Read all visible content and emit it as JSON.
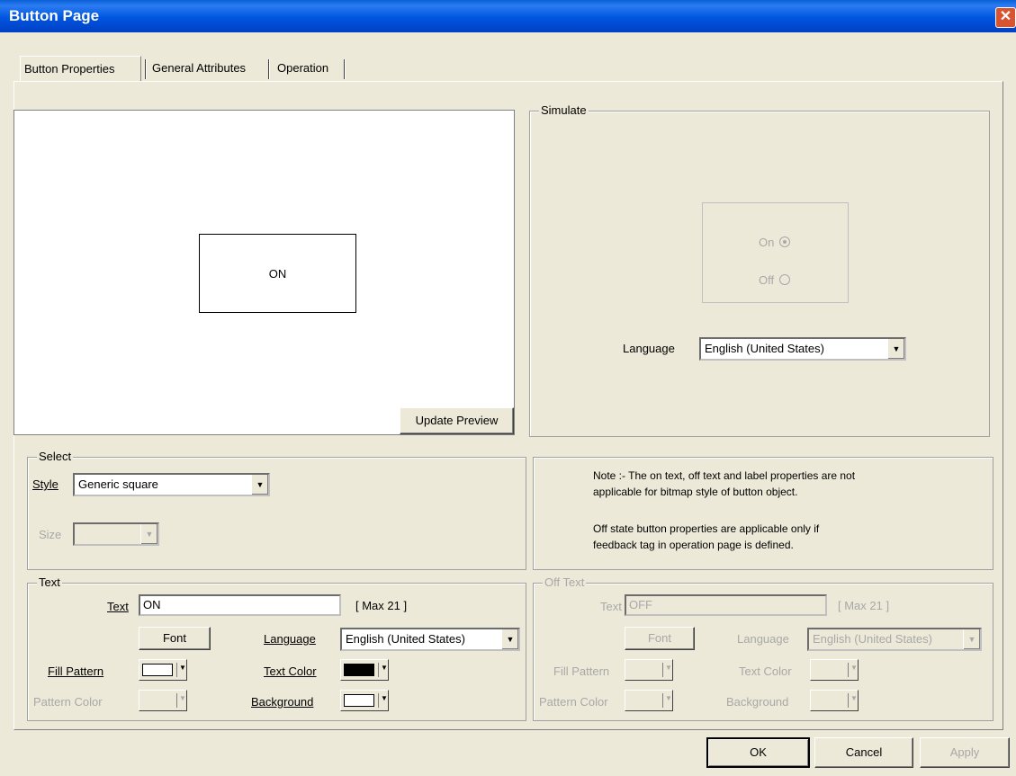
{
  "window": {
    "title": "Button Page",
    "close_glyph": "✕"
  },
  "tabs": [
    {
      "label": "Button Properties",
      "active": true
    },
    {
      "label": "General Attributes",
      "active": false
    },
    {
      "label": "Operation",
      "active": false
    }
  ],
  "preview": {
    "button_text": "ON",
    "update_label": "Update Preview"
  },
  "simulate": {
    "legend": "Simulate",
    "on_label": "On",
    "off_label": "Off",
    "selected": "On",
    "language_label": "Language",
    "language_value": "English (United States)"
  },
  "select": {
    "legend": "Select",
    "style_label": "Style",
    "style_value": "Generic square",
    "size_label": "Size",
    "size_value": ""
  },
  "note": {
    "line1": "Note :- The on text, off text and label properties are  not",
    "line2": "applicable for bitmap style of button object.",
    "line3": "Off state button properties are applicable only if",
    "line4": "feedback tag in operation  page is defined."
  },
  "text_group": {
    "legend": "Text",
    "text_label": "Text",
    "text_value": "ON",
    "max_label": "[ Max 21 ]",
    "font_label": "Font",
    "language_label": "Language",
    "language_value": "English (United States)",
    "fill_pattern_label": "Fill Pattern",
    "pattern_color_label": "Pattern Color",
    "text_color_label": "Text Color",
    "background_label": "Background",
    "fill_pattern_color": "#ffffff",
    "text_color": "#000000",
    "background_color": "#ffffff"
  },
  "off_text_group": {
    "legend": "Off Text",
    "text_label": "Text",
    "text_value": "OFF",
    "max_label": "[ Max 21 ]",
    "font_label": "Font",
    "language_label": "Language",
    "language_value": "English (United States)",
    "fill_pattern_label": "Fill Pattern",
    "pattern_color_label": "Pattern Color",
    "text_color_label": "Text Color",
    "background_label": "Background"
  },
  "footer": {
    "ok_label": "OK",
    "cancel_label": "Cancel",
    "apply_label": "Apply"
  },
  "icons": {
    "dropdown": "chevron-down-icon",
    "close": "close-icon"
  }
}
